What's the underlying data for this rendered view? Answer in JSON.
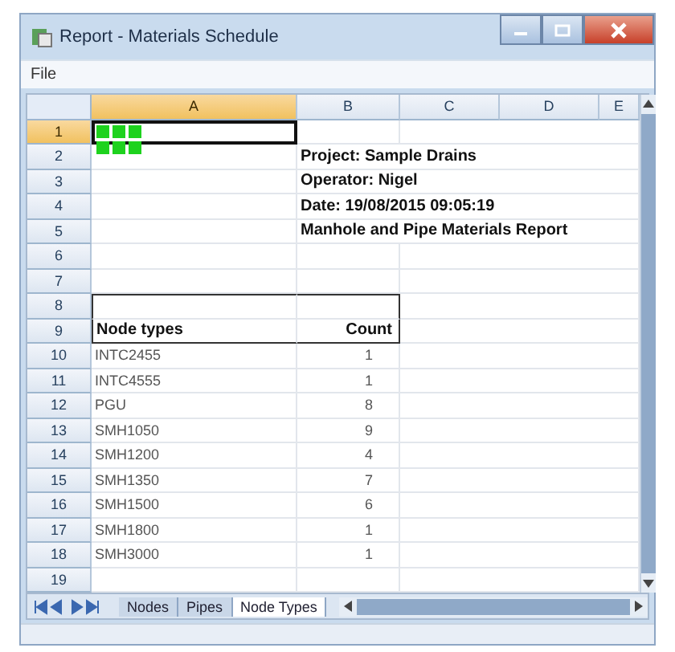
{
  "window": {
    "title": "Report - Materials Schedule"
  },
  "menu": [
    "File"
  ],
  "columns": [
    {
      "label": "A",
      "selected": true
    },
    {
      "label": "B",
      "selected": false
    },
    {
      "label": "C",
      "selected": false
    },
    {
      "label": "D",
      "selected": false
    },
    {
      "label": "E",
      "selected": false
    }
  ],
  "rows": [
    {
      "number": "1",
      "selected": true,
      "kind": "logo"
    },
    {
      "number": "2",
      "selected": false,
      "kind": "info",
      "b": "Project: Sample Drains"
    },
    {
      "number": "3",
      "selected": false,
      "kind": "info",
      "b": "Operator: Nigel"
    },
    {
      "number": "4",
      "selected": false,
      "kind": "info",
      "b": "Date: 19/08/2015 09:05:19"
    },
    {
      "number": "5",
      "selected": false,
      "kind": "info",
      "b": "Manhole and Pipe Materials Report"
    },
    {
      "number": "6",
      "selected": false,
      "kind": "blank"
    },
    {
      "number": "7",
      "selected": false,
      "kind": "blank"
    },
    {
      "number": "8",
      "selected": false,
      "kind": "box-top"
    },
    {
      "number": "9",
      "selected": false,
      "kind": "header",
      "a": "Node types",
      "b": "Count"
    },
    {
      "number": "10",
      "selected": false,
      "kind": "data",
      "a": "INTC2455",
      "b": "1"
    },
    {
      "number": "11",
      "selected": false,
      "kind": "data",
      "a": "INTC4555",
      "b": "1"
    },
    {
      "number": "12",
      "selected": false,
      "kind": "data",
      "a": "PGU",
      "b": "8"
    },
    {
      "number": "13",
      "selected": false,
      "kind": "data",
      "a": "SMH1050",
      "b": "9"
    },
    {
      "number": "14",
      "selected": false,
      "kind": "data",
      "a": "SMH1200",
      "b": "4"
    },
    {
      "number": "15",
      "selected": false,
      "kind": "data",
      "a": "SMH1350",
      "b": "7"
    },
    {
      "number": "16",
      "selected": false,
      "kind": "data",
      "a": "SMH1500",
      "b": "6"
    },
    {
      "number": "17",
      "selected": false,
      "kind": "data",
      "a": "SMH1800",
      "b": "1"
    },
    {
      "number": "18",
      "selected": false,
      "kind": "data",
      "a": "SMH3000",
      "b": "1"
    },
    {
      "number": "19",
      "selected": false,
      "kind": "blank"
    }
  ],
  "sheet_tabs": [
    {
      "label": "Nodes",
      "selected": false
    },
    {
      "label": "Pipes",
      "selected": false
    },
    {
      "label": "Node Types",
      "selected": true
    }
  ]
}
